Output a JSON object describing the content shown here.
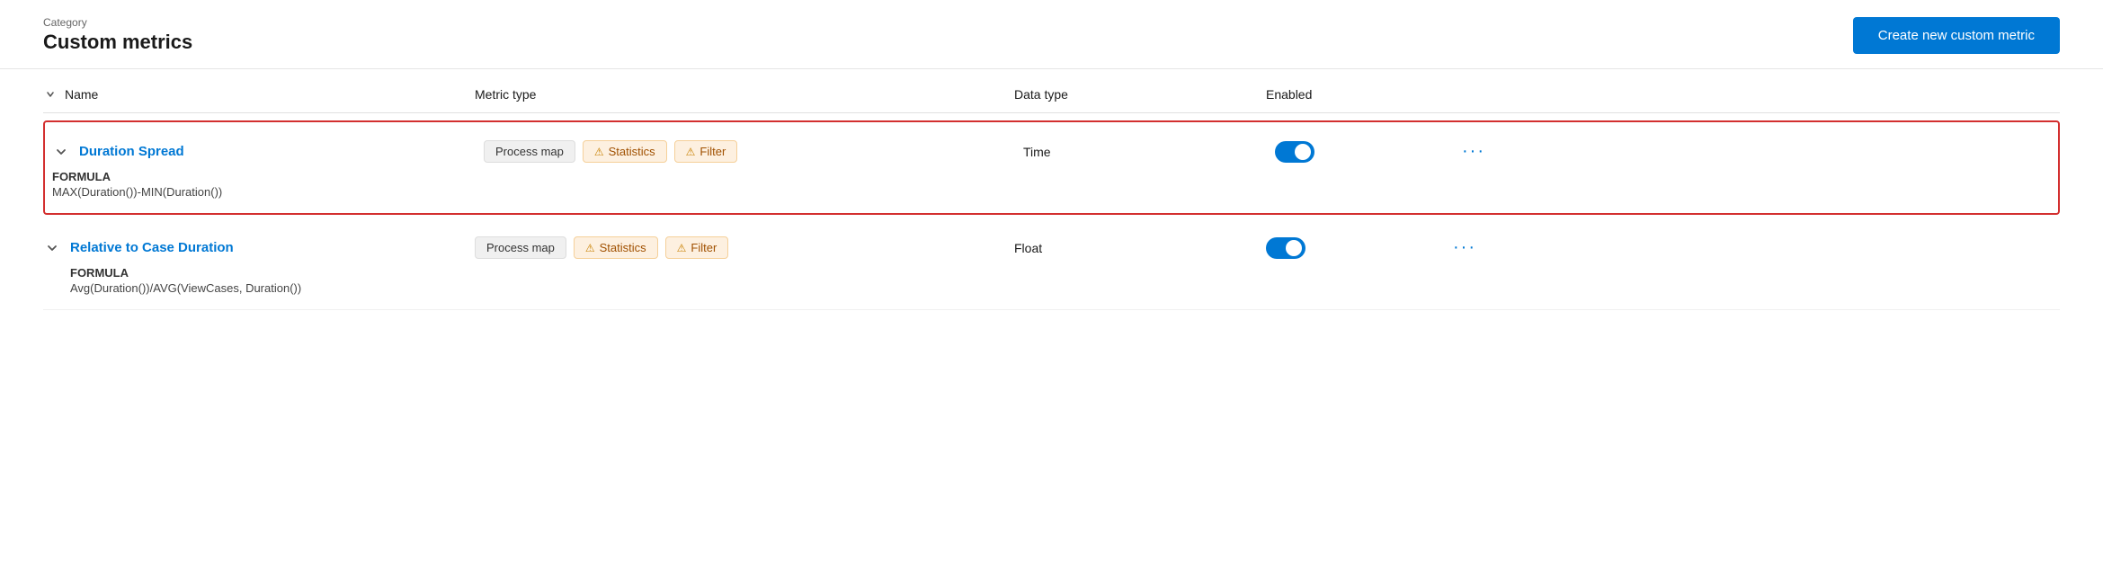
{
  "header": {
    "category_label": "Category",
    "page_title": "Custom metrics",
    "create_button_label": "Create new custom metric"
  },
  "table": {
    "columns": [
      {
        "id": "name",
        "label": "Name"
      },
      {
        "id": "metric_type",
        "label": "Metric type"
      },
      {
        "id": "data_type",
        "label": "Data type"
      },
      {
        "id": "enabled",
        "label": "Enabled"
      }
    ],
    "rows": [
      {
        "id": "row1",
        "name": "Duration Spread",
        "highlighted": true,
        "expanded": true,
        "metric_types": [
          "Process map",
          "Statistics",
          "Filter"
        ],
        "data_type": "Time",
        "enabled": true,
        "formula_label": "FORMULA",
        "formula_value": "MAX(Duration())-MIN(Duration())"
      },
      {
        "id": "row2",
        "name": "Relative to Case Duration",
        "highlighted": false,
        "expanded": true,
        "metric_types": [
          "Process map",
          "Statistics",
          "Filter"
        ],
        "data_type": "Float",
        "enabled": true,
        "formula_label": "FORMULA",
        "formula_value": "Avg(Duration())/AVG(ViewCases, Duration())"
      }
    ]
  },
  "icons": {
    "expand_all": "›",
    "chevron_down": "∨",
    "warning": "⚠",
    "more": "⋯"
  }
}
